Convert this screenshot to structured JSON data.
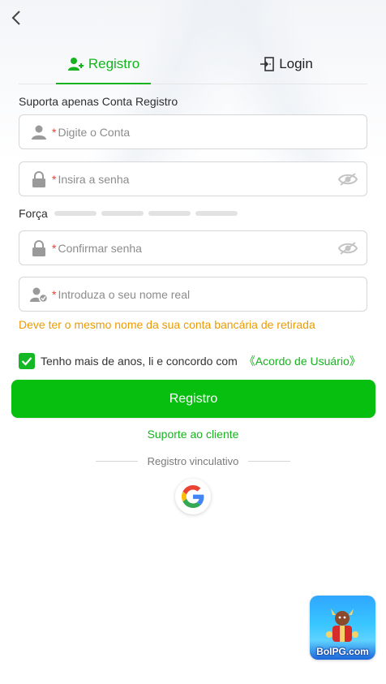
{
  "tabs": {
    "register_label": "Registro",
    "login_label": "Login"
  },
  "form": {
    "support_note": "Suporta apenas Conta Registro",
    "account_placeholder": "Digite o Conta",
    "password_placeholder": "Insira a senha",
    "strength_label": "Força",
    "confirm_placeholder": "Confirmar senha",
    "realname_placeholder": "Introduza o seu nome real",
    "required_mark": "*",
    "realname_warning": "Deve ter o mesmo nome da sua conta bancária de retirada",
    "agree_text": "Tenho mais de anos, li e concordo com",
    "agree_link": "《Acordo de Usuário》",
    "agree_checked": true,
    "submit_label": "Registro"
  },
  "footer": {
    "support_link": "Suporte ao cliente",
    "binding_divider": "Registro vinculativo",
    "social_login_icon": "google-icon"
  },
  "promo": {
    "brand": "BoIPG.com"
  },
  "colors": {
    "accent": "#06bf0e",
    "warning": "#ec9b00",
    "required": "#e0443a"
  }
}
